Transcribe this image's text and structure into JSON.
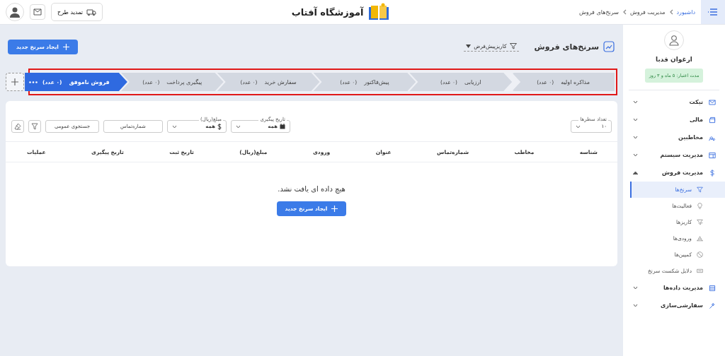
{
  "header": {
    "breadcrumb": [
      "داشبورد",
      "مدیریت فروش",
      "سرنخ‌های فروش"
    ],
    "brand": "آموزشگاه آفتاب",
    "renew_button": "تمدید طرح"
  },
  "page": {
    "title": "سرنخ‌های فروش",
    "pipeline_select": "کاریزپیش‌فرض",
    "new_button": "ایجاد سرنخ جدید"
  },
  "stages": [
    {
      "label": "مذاکره اولیه",
      "count": "(۰ عدد)",
      "selected": false
    },
    {
      "label": "ارزیابی",
      "count": "(۰ عدد)",
      "selected": false
    },
    {
      "label": "پیش‌فاکتور",
      "count": "(۰ عدد)",
      "selected": false
    },
    {
      "label": "سفارش خرید",
      "count": "(۰ عدد)",
      "selected": false
    },
    {
      "label": "پیگیری پرداخت",
      "count": "(۰ عدد)",
      "selected": false
    },
    {
      "label": "فروش ناموفق",
      "count": "(۰ عدد)",
      "selected": true
    }
  ],
  "filters": {
    "rows": {
      "label": "تعداد سطرها",
      "value": "۱۰"
    },
    "follow_date": {
      "label": "تاریخ پیگیری",
      "value": "همه"
    },
    "amount": {
      "label": "مبلغ(ریال)",
      "value": "همه"
    },
    "phone": {
      "placeholder": "شماره‌تماس"
    },
    "search": {
      "placeholder": "جستجوی عمومی"
    }
  },
  "table": {
    "columns": [
      "شناسه",
      "مخاطب",
      "شماره‌تماس",
      "عنوان",
      "ورودی",
      "مبلغ(ریال)",
      "تاریخ ثبت",
      "تاریخ پیگیری",
      "عملیات"
    ],
    "empty_message": "هیچ داده ای یافت نشد.",
    "empty_button": "ایجاد سرنخ جدید"
  },
  "sidebar": {
    "user_name": "ارغوان قدبا",
    "validity": "مدت اعتبار: ۵ ماه و ۳ روز",
    "items": [
      {
        "label": "تیکت",
        "expanded": false
      },
      {
        "label": "مالی",
        "expanded": false
      },
      {
        "label": "مخاطبین",
        "expanded": false
      },
      {
        "label": "مدیریت سیستم",
        "expanded": false
      },
      {
        "label": "مدیریت فروش",
        "expanded": true,
        "children": [
          {
            "label": "سرنخ‌ها",
            "selected": true
          },
          {
            "label": "فعالیت‌ها",
            "selected": false
          },
          {
            "label": "کاریزها",
            "selected": false
          },
          {
            "label": "ورودی‌ها",
            "selected": false
          },
          {
            "label": "کمپین‌ها",
            "selected": false
          },
          {
            "label": "دلایل شکست سرنخ",
            "selected": false
          }
        ]
      },
      {
        "label": "مدیریت داده‌ها",
        "expanded": false
      },
      {
        "label": "سفارشی‌سازی",
        "expanded": false
      }
    ]
  }
}
